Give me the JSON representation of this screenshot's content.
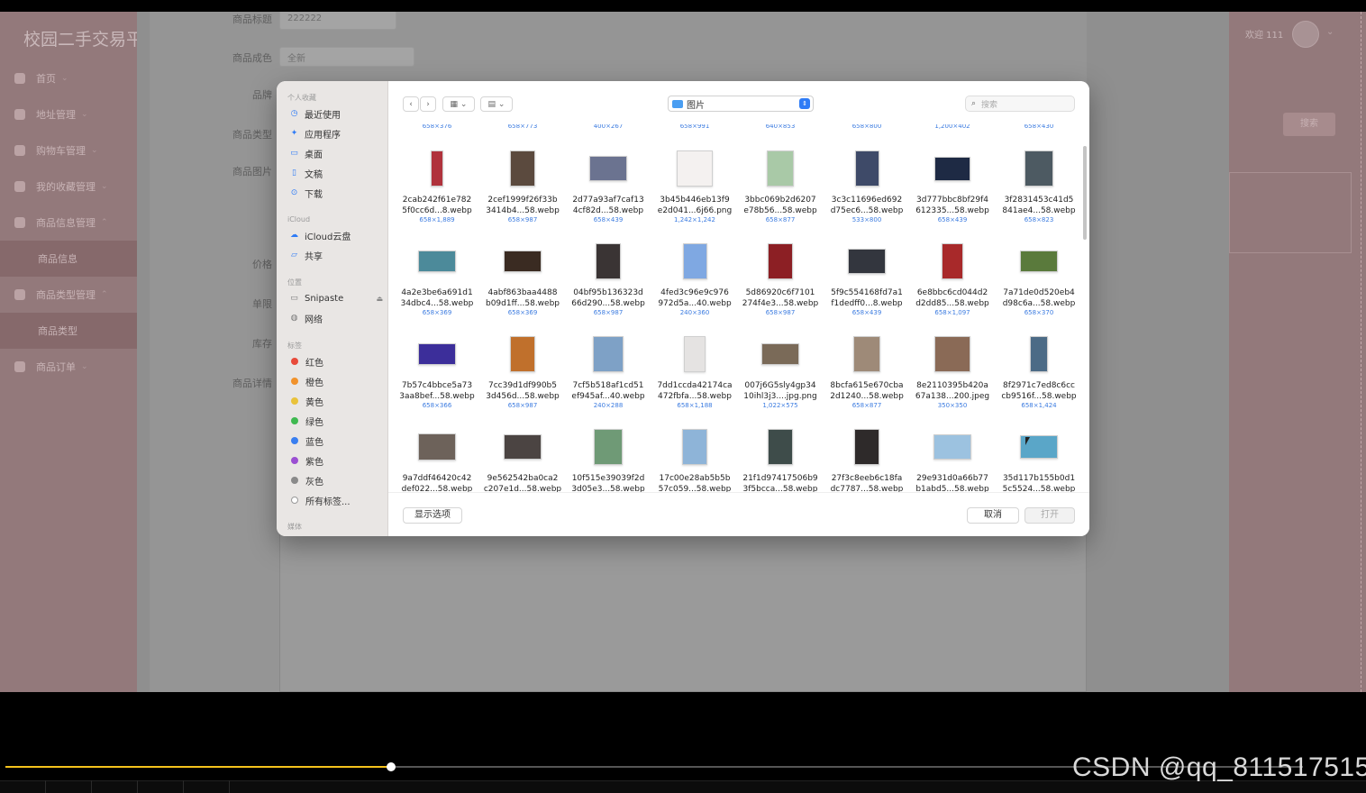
{
  "app": {
    "brand": "校园二手交易平",
    "nav": [
      {
        "label": "首页"
      },
      {
        "label": "地址管理"
      },
      {
        "label": "购物车管理"
      },
      {
        "label": "我的收藏管理"
      },
      {
        "label": "商品信息管理"
      },
      {
        "label": "商品信息"
      },
      {
        "label": "商品类型管理"
      },
      {
        "label": "商品类型"
      },
      {
        "label": "商品订单"
      }
    ],
    "welcome": "欢迎 111",
    "search_button": "搜索"
  },
  "form": {
    "labels": [
      "商品标题",
      "商品成色",
      "品牌",
      "商品类型",
      "商品图片",
      "价格",
      "单限",
      "库存",
      "商品详情"
    ],
    "title_value": "222222",
    "condition_value": "全新"
  },
  "dialog": {
    "sidebar": {
      "favorites_heading": "个人收藏",
      "favorites": [
        "最近使用",
        "应用程序",
        "桌面",
        "文稿",
        "下载"
      ],
      "icloud_heading": "iCloud",
      "icloud": [
        "iCloud云盘",
        "共享"
      ],
      "locations_heading": "位置",
      "locations": [
        "Snipaste",
        "网络"
      ],
      "tags_heading": "标签",
      "tags": [
        {
          "label": "红色",
          "color": "#e84a3a"
        },
        {
          "label": "橙色",
          "color": "#f1922b"
        },
        {
          "label": "黄色",
          "color": "#e9c23a"
        },
        {
          "label": "绿色",
          "color": "#3fb950"
        },
        {
          "label": "蓝色",
          "color": "#3a7ff0"
        },
        {
          "label": "紫色",
          "color": "#9b4fd2"
        },
        {
          "label": "灰色",
          "color": "#8a8a8a"
        },
        {
          "label": "所有标签..."
        }
      ],
      "media_heading": "媒体"
    },
    "location": "图片",
    "search_placeholder": "搜索",
    "top_row_dims": [
      "658×376",
      "658×773",
      "400×267",
      "658×991",
      "640×853",
      "658×800",
      "1,200×402",
      "658×430"
    ],
    "files": [
      {
        "l1": "2cab242f61e782",
        "l2": "5f0cc6d...8.webp",
        "dim": "658×1,889",
        "color": "#b0323c",
        "w": 14,
        "h": 40
      },
      {
        "l1": "2cef1999f26f33b",
        "l2": "3414b4...58.webp",
        "dim": "658×987",
        "color": "#5b4a3e",
        "w": 28,
        "h": 40
      },
      {
        "l1": "2d77a93af7caf13",
        "l2": "4cf82d...58.webp",
        "dim": "658×439",
        "color": "#6b7390",
        "w": 42,
        "h": 28
      },
      {
        "l1": "3b45b446eb13f9",
        "l2": "e2d041...6j66.png",
        "dim": "1,242×1,242",
        "color": "#f4f1f0",
        "w": 40,
        "h": 40
      },
      {
        "l1": "3bbc069b2d6207",
        "l2": "e78b56...58.webp",
        "dim": "658×877",
        "color": "#a9c9a7",
        "w": 30,
        "h": 40
      },
      {
        "l1": "3c3c11696ed692",
        "l2": "d75ec6...58.webp",
        "dim": "533×800",
        "color": "#3e4a68",
        "w": 27,
        "h": 40
      },
      {
        "l1": "3d777bbc8bf29f4",
        "l2": "612335...58.webp",
        "dim": "658×439",
        "color": "#1e2a44",
        "w": 40,
        "h": 27
      },
      {
        "l1": "3f2831453c41d5",
        "l2": "841ae4...58.webp",
        "dim": "658×823",
        "color": "#4d5a62",
        "w": 32,
        "h": 40
      },
      {
        "l1": "4a2e3be6a691d1",
        "l2": "34dbc4...58.webp",
        "dim": "658×369",
        "color": "#4c8a9a",
        "w": 42,
        "h": 24
      },
      {
        "l1": "4abf863baa4488",
        "l2": "b09d1ff...58.webp",
        "dim": "658×369",
        "color": "#3a2b22",
        "w": 42,
        "h": 24
      },
      {
        "l1": "04bf95b136323d",
        "l2": "66d290...58.webp",
        "dim": "658×987",
        "color": "#3a3434",
        "w": 28,
        "h": 40
      },
      {
        "l1": "4fed3c96e9c976",
        "l2": "972d5a...40.webp",
        "dim": "240×360",
        "color": "#7fa8e2",
        "w": 27,
        "h": 40
      },
      {
        "l1": "5d86920c6f7101",
        "l2": "274f4e3...58.webp",
        "dim": "658×987",
        "color": "#8c1f24",
        "w": 28,
        "h": 40
      },
      {
        "l1": "5f9c554168fd7a1",
        "l2": "f1dedff0...8.webp",
        "dim": "658×439",
        "color": "#33363e",
        "w": 42,
        "h": 28
      },
      {
        "l1": "6e8bbc6cd044d2",
        "l2": "d2dd85...58.webp",
        "dim": "658×1,097",
        "color": "#a8292a",
        "w": 24,
        "h": 40
      },
      {
        "l1": "7a71de0d520eb4",
        "l2": "d98c6a...58.webp",
        "dim": "658×370",
        "color": "#5a7a3c",
        "w": 42,
        "h": 24
      },
      {
        "l1": "7b57c4bbce5a73",
        "l2": "3aa8bef...58.webp",
        "dim": "658×366",
        "color": "#3c2e9a",
        "w": 42,
        "h": 24
      },
      {
        "l1": "7cc39d1df990b5",
        "l2": "3d456d...58.webp",
        "dim": "658×987",
        "color": "#c0702c",
        "w": 28,
        "h": 40
      },
      {
        "l1": "7cf5b518af1cd51",
        "l2": "ef945af...40.webp",
        "dim": "240×288",
        "color": "#7ea1c6",
        "w": 34,
        "h": 40
      },
      {
        "l1": "7dd1ccda42174ca",
        "l2": "472fbfa...58.webp",
        "dim": "658×1,188",
        "color": "#e5e3e2",
        "w": 24,
        "h": 40
      },
      {
        "l1": "007j6G5sly4gp34",
        "l2": "10ihl3j3....jpg.png",
        "dim": "1,022×575",
        "color": "#7a6a58",
        "w": 42,
        "h": 24
      },
      {
        "l1": "8bcfa615e670cba",
        "l2": "2d1240...58.webp",
        "dim": "658×877",
        "color": "#9e8a78",
        "w": 30,
        "h": 40
      },
      {
        "l1": "8e2110395b420a",
        "l2": "67a138...200.jpeg",
        "dim": "350×350",
        "color": "#8a6a56",
        "w": 40,
        "h": 40
      },
      {
        "l1": "8f2971c7ed8c6cc",
        "l2": "cb9516f...58.webp",
        "dim": "658×1,424",
        "color": "#4c6b86",
        "w": 20,
        "h": 40
      },
      {
        "l1": "9a7ddf46420c42",
        "l2": "def022...58.webp",
        "dim": "",
        "color": "#6d625a",
        "w": 42,
        "h": 30
      },
      {
        "l1": "9e562542ba0ca2",
        "l2": "c207e1d...58.webp",
        "dim": "",
        "color": "#4b4442",
        "w": 42,
        "h": 28
      },
      {
        "l1": "10f515e39039f2d",
        "l2": "3d05e3...58.webp",
        "dim": "",
        "color": "#6f9a76",
        "w": 32,
        "h": 40
      },
      {
        "l1": "17c00e28ab5b5b",
        "l2": "57c059...58.webp",
        "dim": "",
        "color": "#8eb4d8",
        "w": 28,
        "h": 40
      },
      {
        "l1": "21f1d97417506b9",
        "l2": "3f5bcca...58.webp",
        "dim": "",
        "color": "#3e4c4a",
        "w": 28,
        "h": 40
      },
      {
        "l1": "27f3c8eeb6c18fa",
        "l2": "dc7787...58.webp",
        "dim": "",
        "color": "#2e2a2a",
        "w": 28,
        "h": 40
      },
      {
        "l1": "29e931d0a66b77",
        "l2": "b1abd5...58.webp",
        "dim": "",
        "color": "#9cc2e0",
        "w": 42,
        "h": 28
      },
      {
        "l1": "35d117b155b0d1",
        "l2": "5c5524...58.webp",
        "dim": "",
        "color": "#5aa6c8",
        "w": 42,
        "h": 26
      }
    ],
    "show_options": "显示选项",
    "cancel": "取消",
    "open": "打开"
  },
  "player": {
    "progress": 0.297,
    "watermark": "CSDN @qq_811517515"
  }
}
